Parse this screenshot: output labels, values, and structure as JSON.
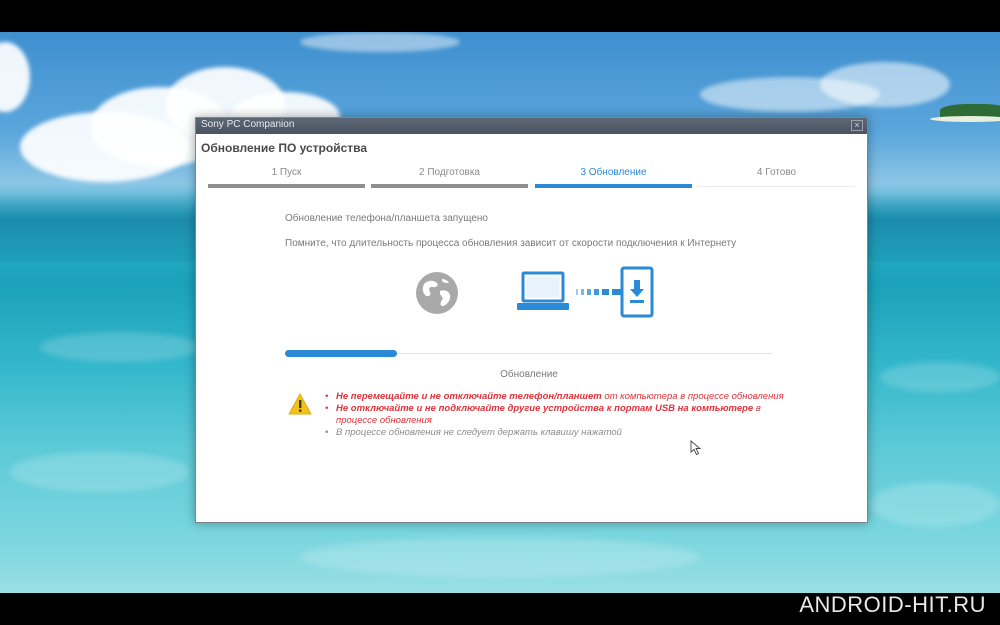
{
  "watermark": "ANDROID-HIT.RU",
  "window": {
    "title": "Sony PC Companion",
    "close_glyph": "×",
    "page_title": "Обновление ПО устройства"
  },
  "steps": [
    {
      "label": "1  Пуск",
      "state": "done"
    },
    {
      "label": "2  Подготовка",
      "state": "done"
    },
    {
      "label": "3  Обновление",
      "state": "active"
    },
    {
      "label": "4  Готово",
      "state": "future"
    }
  ],
  "messages": {
    "started": "Обновление телефона/планшета запущено",
    "note": "Помните, что длительность процесса обновления зависит от скорости подключения к Интернету"
  },
  "icons": {
    "globe": "globe-icon",
    "laptop": "laptop-icon",
    "transfer": "transfer-arrows-icon",
    "phone": "phone-download-icon",
    "warning": "warning-icon"
  },
  "progress": {
    "fraction": 0.23,
    "label": "Обновление"
  },
  "warnings": [
    {
      "bold": "Не перемещайте и не отключайте телефон/планшет",
      "rest": " от компьютера в процессе обновления",
      "style": "red"
    },
    {
      "bold": "Не отключайте и не подключайте другие устройства к портам USB на компьютере",
      "rest": " в процессе обновления",
      "style": "red"
    },
    {
      "bold": "",
      "rest": "В процессе обновления не следует держать клавишу нажатой",
      "style": "gray"
    }
  ],
  "colors": {
    "accent": "#2b8ad6",
    "warning_red": "#e0323a",
    "warning_yellow": "#f2c21b"
  }
}
